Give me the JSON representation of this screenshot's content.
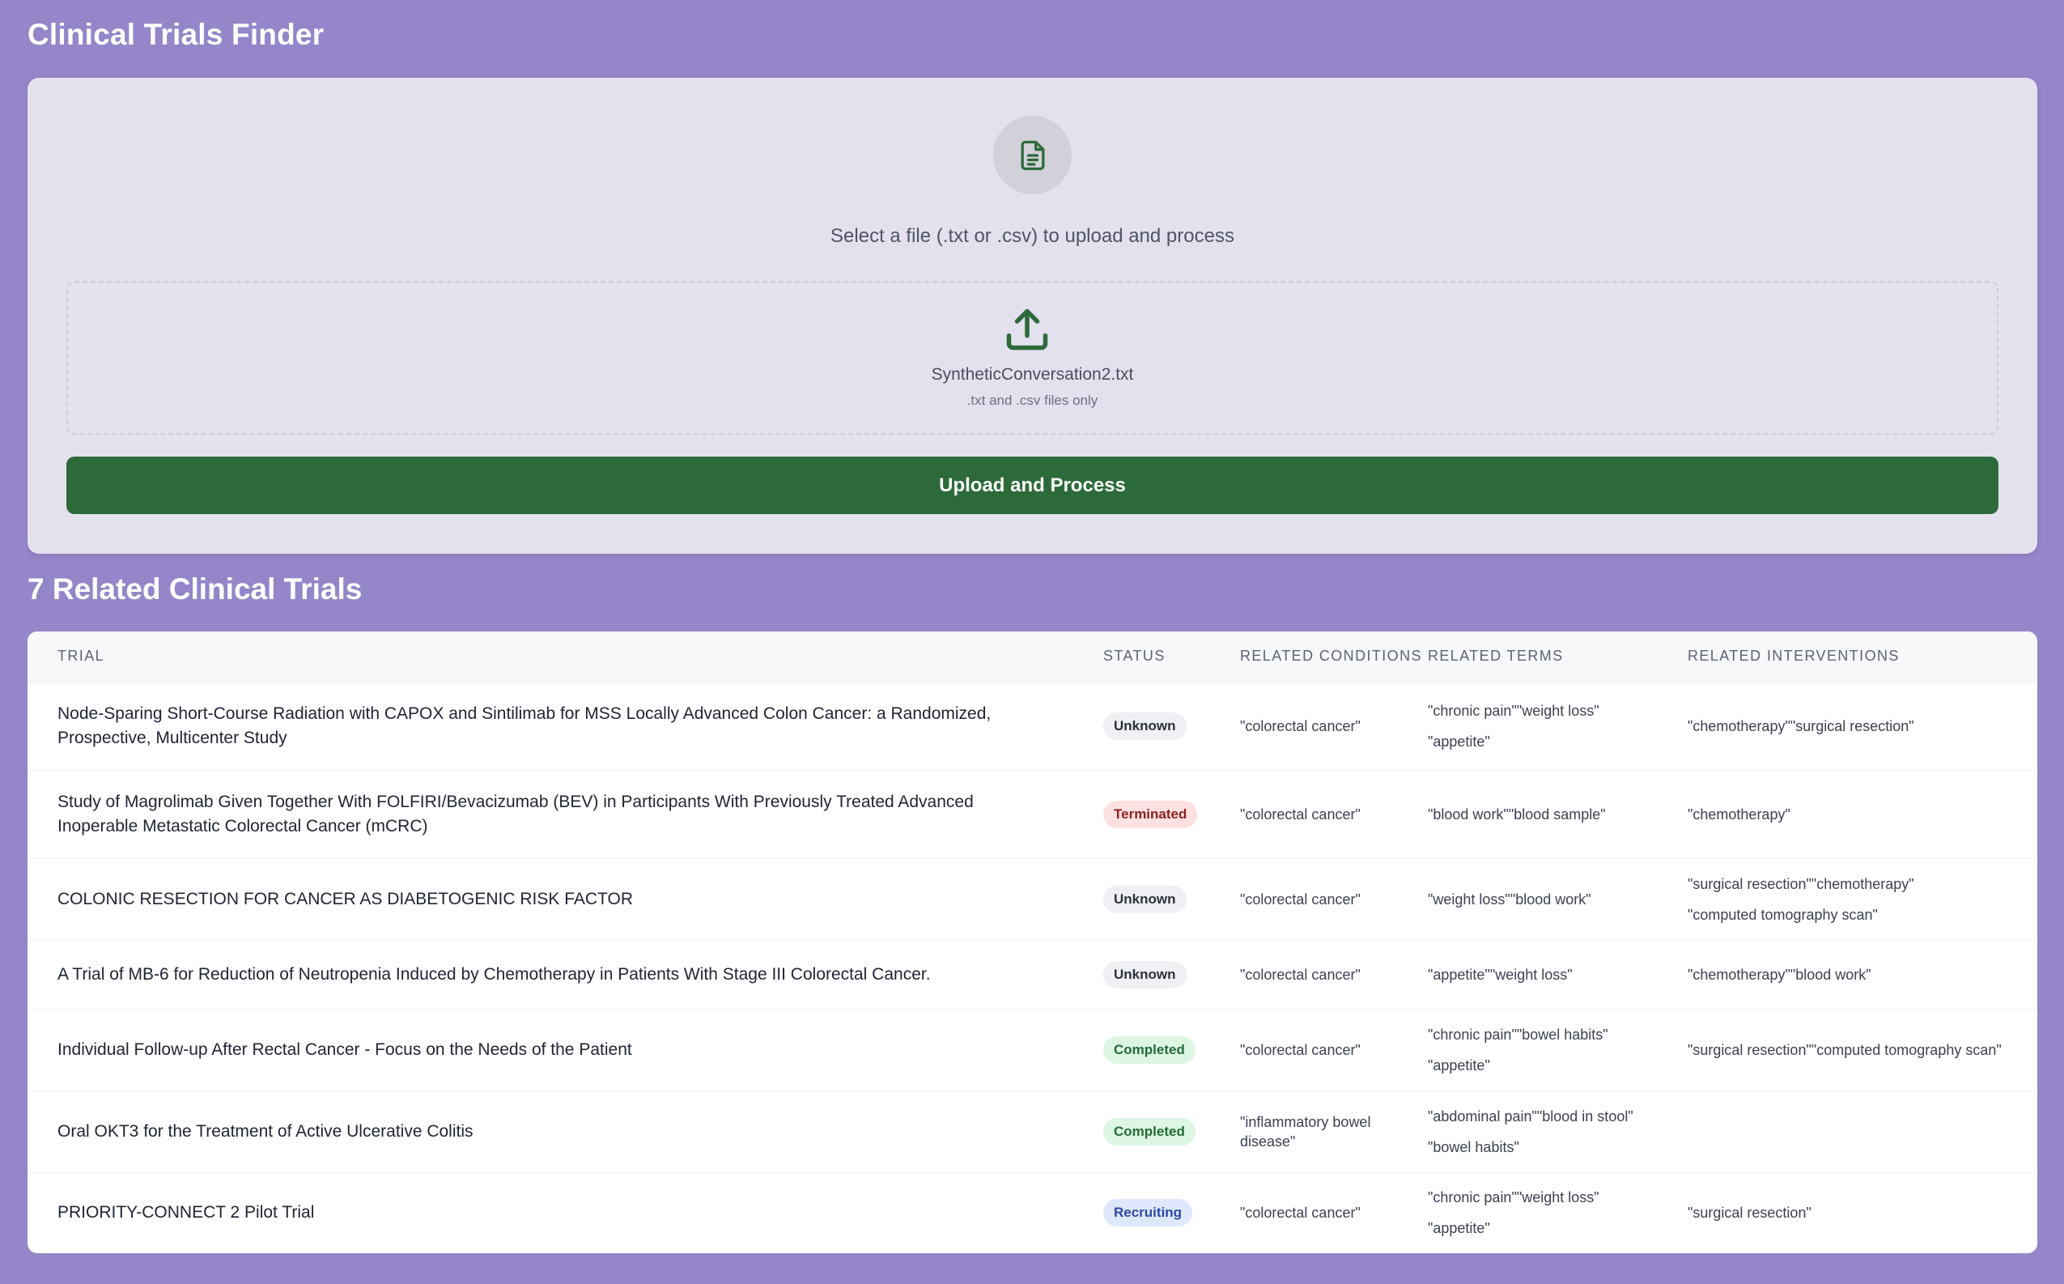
{
  "app": {
    "title": "Clinical Trials Finder"
  },
  "upload": {
    "doc_icon": "document-icon",
    "prompt": "Select a file (.txt or .csv) to upload and process",
    "upload_icon": "upload-icon",
    "file_name": "SyntheticConversation2.txt",
    "hint": ".txt and .csv files only",
    "button_label": "Upload and Process"
  },
  "results": {
    "title": "7 Related Clinical Trials",
    "columns": [
      "TRIAL",
      "STATUS",
      "RELATED CONDITIONS",
      "RELATED TERMS",
      "RELATED INTERVENTIONS"
    ],
    "rows": [
      {
        "trial": "Node-Sparing Short-Course Radiation with CAPOX and Sintilimab for MSS Locally Advanced Colon Cancer: a Randomized, Prospective, Multicenter Study",
        "status": "Unknown",
        "conditions": "\"colorectal cancer\"",
        "terms": [
          "\"chronic pain\"\"weight loss\"",
          "\"appetite\""
        ],
        "interventions": [
          "\"chemotherapy\"\"surgical resection\""
        ]
      },
      {
        "trial": "Study of Magrolimab Given Together With FOLFIRI/Bevacizumab (BEV) in Participants With Previously Treated Advanced Inoperable Metastatic Colorectal Cancer (mCRC)",
        "status": "Terminated",
        "conditions": "\"colorectal cancer\"",
        "terms": [
          "\"blood work\"\"blood sample\""
        ],
        "interventions": [
          "\"chemotherapy\""
        ]
      },
      {
        "trial": "COLONIC RESECTION FOR CANCER AS DIABETOGENIC RISK FACTOR",
        "status": "Unknown",
        "conditions": "\"colorectal cancer\"",
        "terms": [
          "\"weight loss\"\"blood work\""
        ],
        "interventions": [
          "\"surgical resection\"\"chemotherapy\"",
          "\"computed tomography scan\""
        ]
      },
      {
        "trial": "A Trial of MB-6 for Reduction of Neutropenia Induced by Chemotherapy in Patients With Stage III Colorectal Cancer.",
        "status": "Unknown",
        "conditions": "\"colorectal cancer\"",
        "terms": [
          "\"appetite\"\"weight loss\""
        ],
        "interventions": [
          "\"chemotherapy\"\"blood work\""
        ]
      },
      {
        "trial": "Individual Follow-up After Rectal Cancer - Focus on the Needs of the Patient",
        "status": "Completed",
        "conditions": "\"colorectal cancer\"",
        "terms": [
          "\"chronic pain\"\"bowel habits\"",
          "\"appetite\""
        ],
        "interventions": [
          "\"surgical resection\"\"computed tomography scan\""
        ]
      },
      {
        "trial": "Oral OKT3 for the Treatment of Active Ulcerative Colitis",
        "status": "Completed",
        "conditions": "\"inflammatory bowel disease\"",
        "terms": [
          "\"abdominal pain\"\"blood in stool\"",
          "\"bowel habits\""
        ],
        "interventions": []
      },
      {
        "trial": "PRIORITY-CONNECT 2 Pilot Trial",
        "status": "Recruiting",
        "conditions": "\"colorectal cancer\"",
        "terms": [
          "\"chronic pain\"\"weight loss\"",
          "\"appetite\""
        ],
        "interventions": [
          "\"surgical resection\""
        ]
      }
    ]
  },
  "colors": {
    "background": "#9586c9",
    "card": "#e4e1ef",
    "primary_button": "#2d6a3a",
    "icon_green": "#2d6a3a"
  }
}
